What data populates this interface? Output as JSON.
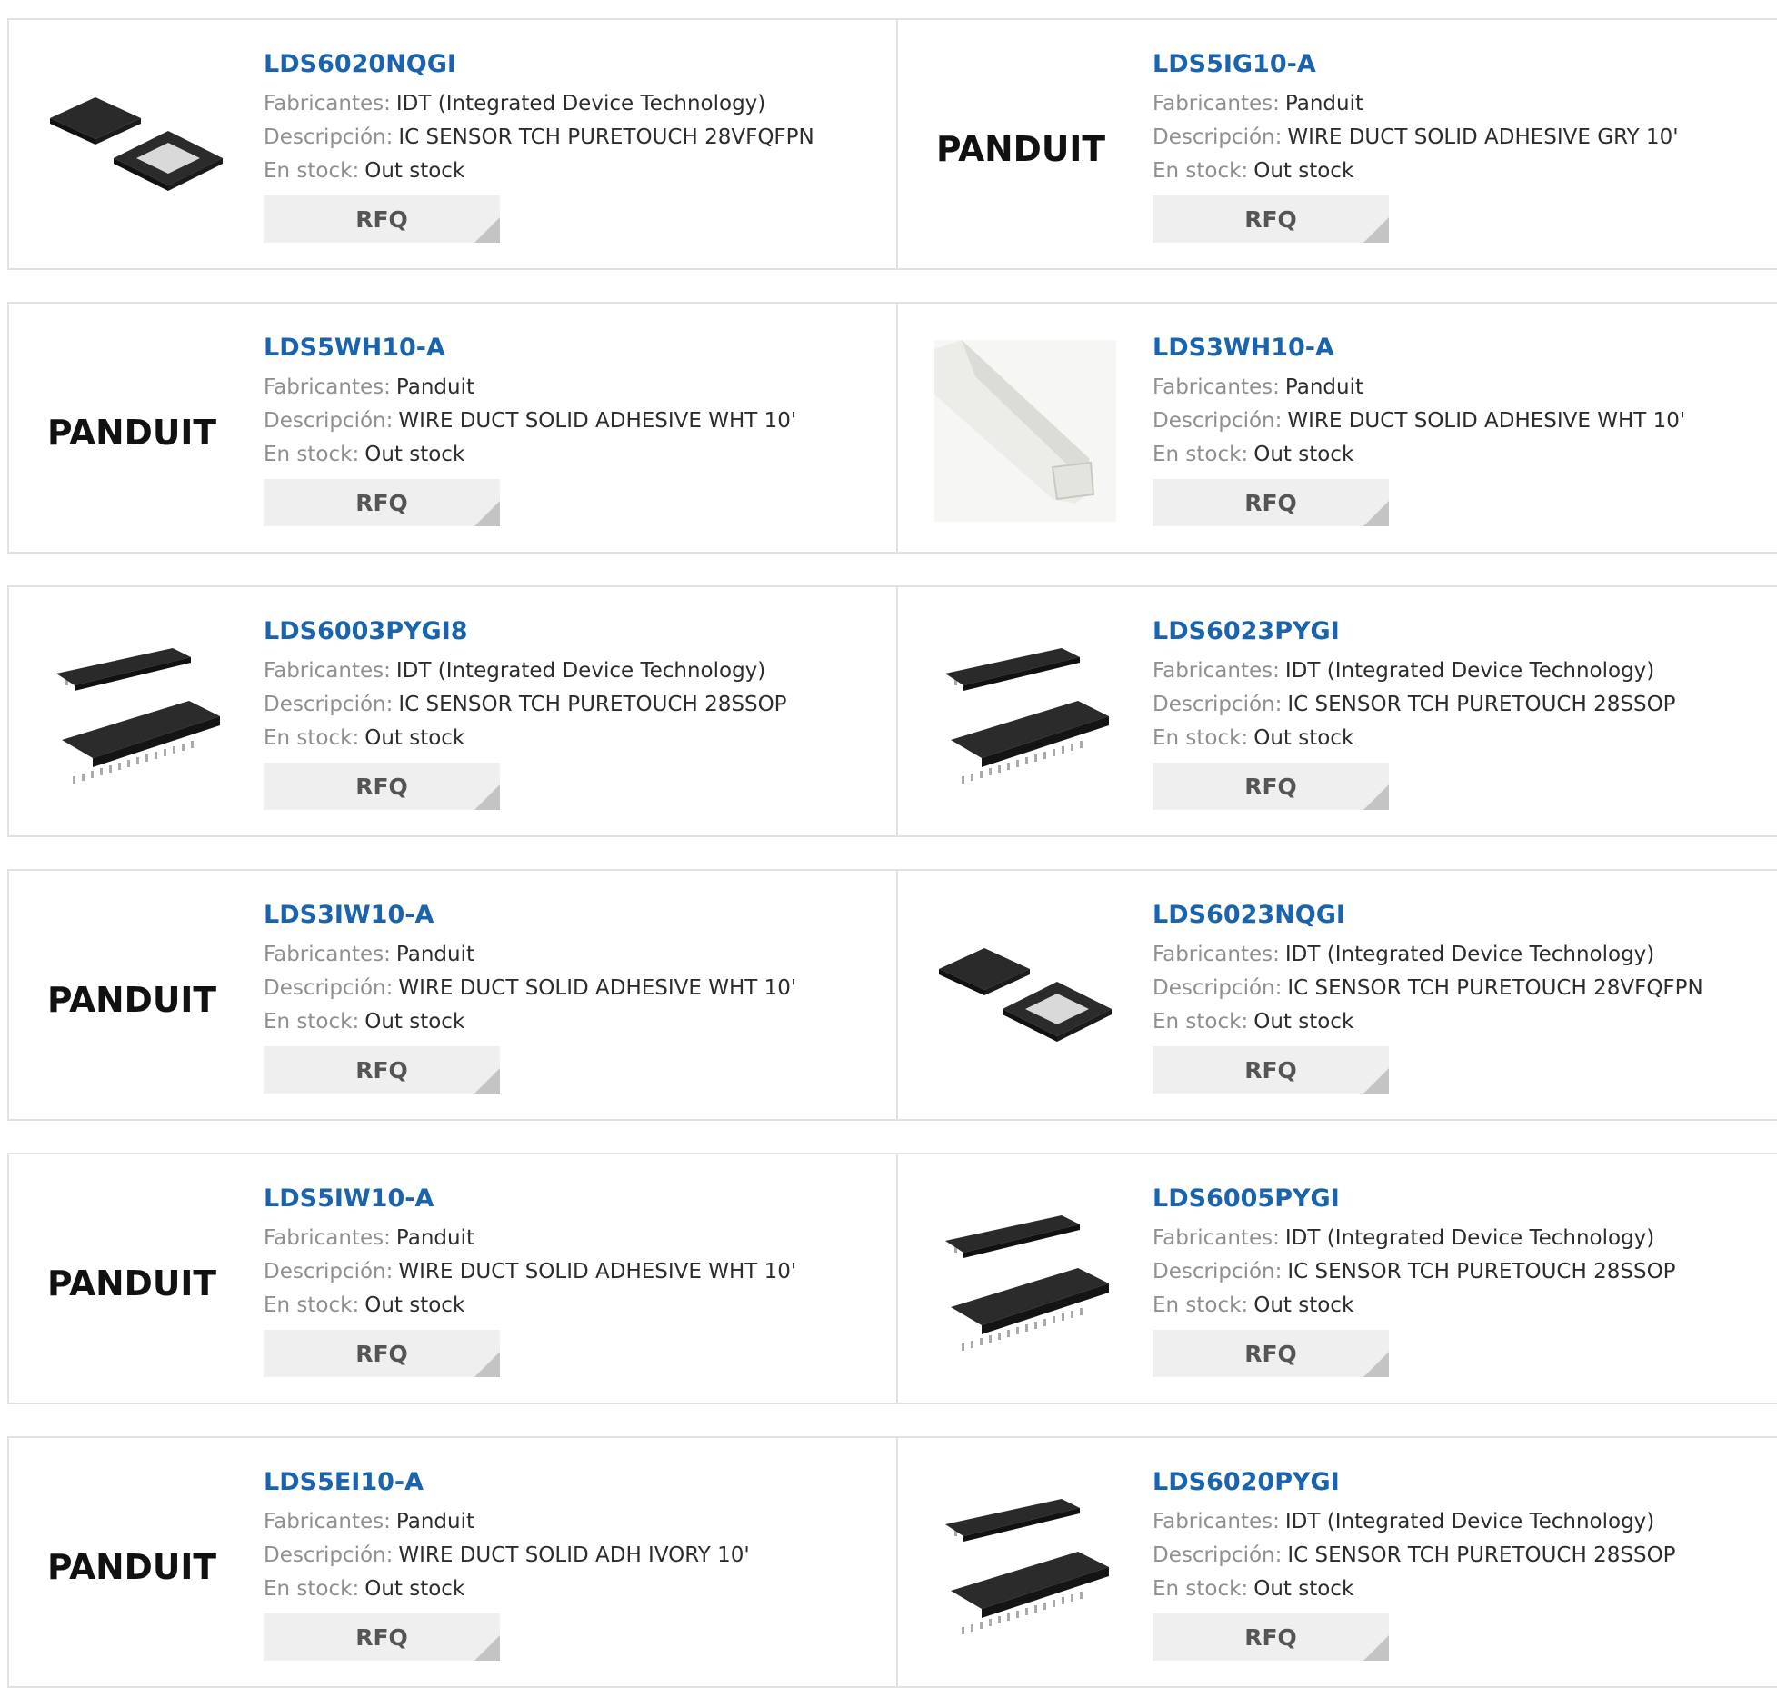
{
  "labels": {
    "manufacturer": "Fabricantes:",
    "description": "Descripción:",
    "stock": "En stock:",
    "rfq": "RFQ"
  },
  "colors": {
    "part_link": "#1a63ae",
    "label": "#8f8f8f",
    "text": "#2c2c2c",
    "button_bg": "#efefef",
    "border": "#e2e2e2"
  },
  "products": [
    {
      "part": "LDS6020NQGI",
      "manufacturer": "IDT (Integrated Device Technology)",
      "description": "IC SENSOR TCH PURETOUCH 28VFQFPN",
      "stock": "Out stock",
      "image": "qfn-chip-icon"
    },
    {
      "part": "LDS5IG10-A",
      "manufacturer": "Panduit",
      "description": "WIRE DUCT SOLID ADHESIVE GRY 10'",
      "stock": "Out stock",
      "image": "panduit-logo",
      "logo_text": "PANDUIT"
    },
    {
      "part": "LDS5WH10-A",
      "manufacturer": "Panduit",
      "description": "WIRE DUCT SOLID ADHESIVE WHT 10'",
      "stock": "Out stock",
      "image": "panduit-logo",
      "logo_text": "PANDUIT"
    },
    {
      "part": "LDS3WH10-A",
      "manufacturer": "Panduit",
      "description": "WIRE DUCT SOLID ADHESIVE WHT 10'",
      "stock": "Out stock",
      "image": "wire-duct-icon"
    },
    {
      "part": "LDS6003PYGI8",
      "manufacturer": "IDT (Integrated Device Technology)",
      "description": "IC SENSOR TCH PURETOUCH 28SSOP",
      "stock": "Out stock",
      "image": "ssop-chip-icon"
    },
    {
      "part": "LDS6023PYGI",
      "manufacturer": "IDT (Integrated Device Technology)",
      "description": "IC SENSOR TCH PURETOUCH 28SSOP",
      "stock": "Out stock",
      "image": "ssop-chip-icon"
    },
    {
      "part": "LDS3IW10-A",
      "manufacturer": "Panduit",
      "description": "WIRE DUCT SOLID ADHESIVE WHT 10'",
      "stock": "Out stock",
      "image": "panduit-logo",
      "logo_text": "PANDUIT"
    },
    {
      "part": "LDS6023NQGI",
      "manufacturer": "IDT (Integrated Device Technology)",
      "description": "IC SENSOR TCH PURETOUCH 28VFQFPN",
      "stock": "Out stock",
      "image": "qfn-chip-icon"
    },
    {
      "part": "LDS5IW10-A",
      "manufacturer": "Panduit",
      "description": "WIRE DUCT SOLID ADHESIVE WHT 10'",
      "stock": "Out stock",
      "image": "panduit-logo",
      "logo_text": "PANDUIT"
    },
    {
      "part": "LDS6005PYGI",
      "manufacturer": "IDT (Integrated Device Technology)",
      "description": "IC SENSOR TCH PURETOUCH 28SSOP",
      "stock": "Out stock",
      "image": "ssop-chip-icon"
    },
    {
      "part": "LDS5EI10-A",
      "manufacturer": "Panduit",
      "description": "WIRE DUCT SOLID ADH IVORY 10'",
      "stock": "Out stock",
      "image": "panduit-logo",
      "logo_text": "PANDUIT"
    },
    {
      "part": "LDS6020PYGI",
      "manufacturer": "IDT (Integrated Device Technology)",
      "description": "IC SENSOR TCH PURETOUCH 28SSOP",
      "stock": "Out stock",
      "image": "ssop-chip-icon"
    }
  ]
}
